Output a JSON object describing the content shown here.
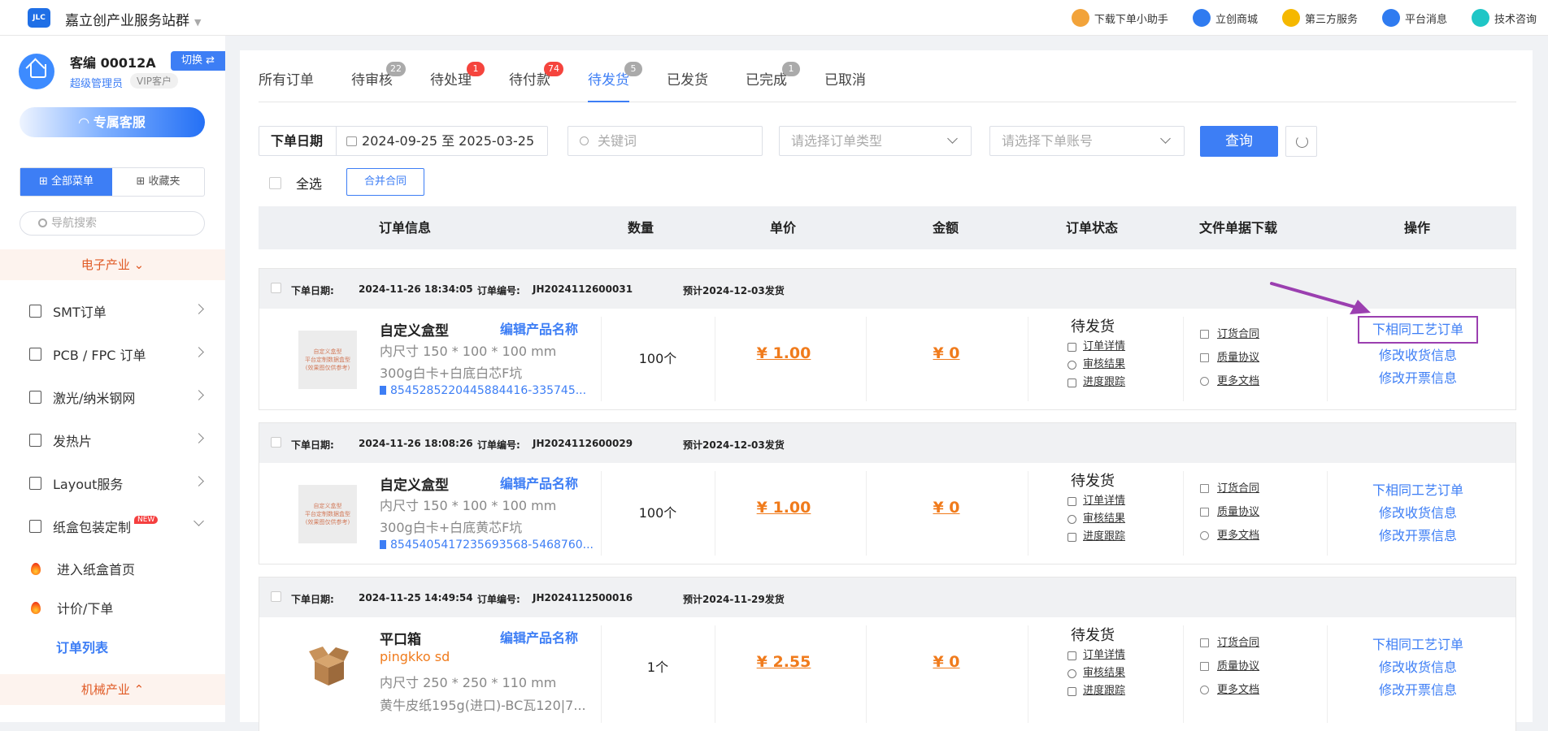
{
  "topbar": {
    "logo_text": "JLC",
    "site_title": "嘉立创产业服务站群",
    "nav": [
      {
        "label": "下载下单小助手",
        "icon": "assistant-icon",
        "color": "#f2a33a"
      },
      {
        "label": "立创商城",
        "icon": "mall-icon",
        "color": "#2f7bf0"
      },
      {
        "label": "第三方服务",
        "icon": "grid-icon",
        "color": "#f5b800"
      },
      {
        "label": "平台消息",
        "icon": "bell-icon",
        "color": "#2f7bf0"
      },
      {
        "label": "技术咨询",
        "icon": "chat-icon",
        "color": "#1fc6c6"
      }
    ]
  },
  "sidebar": {
    "user_name": "客编 00012A",
    "switch_label": "切换 ⇄",
    "role": "超级管理员",
    "vip": "VIP客户",
    "cs_button": "专属客服",
    "menu_tabs": [
      "全部菜单",
      "收藏夹"
    ],
    "search_placeholder": "导航搜索",
    "category_electronics": "电子产业",
    "items": [
      {
        "label": "SMT订单",
        "icon": "smt-icon"
      },
      {
        "label": "PCB / FPC 订单",
        "icon": "pcb-icon"
      },
      {
        "label": "激光/纳米钢网",
        "icon": "stencil-icon"
      },
      {
        "label": "发热片",
        "icon": "heater-icon"
      },
      {
        "label": "Layout服务",
        "icon": "layout-icon"
      },
      {
        "label": "纸盒包装定制",
        "icon": "box-icon",
        "badge": "NEW"
      }
    ],
    "sub_items": [
      "进入纸盒首页",
      "计价/下单",
      "订单列表"
    ],
    "category_machinery": "机械产业"
  },
  "tabs": [
    {
      "label": "所有订单"
    },
    {
      "label": "待审核",
      "badge": "22"
    },
    {
      "label": "待处理",
      "badge": "1"
    },
    {
      "label": "待付款",
      "badge": "74"
    },
    {
      "label": "待发货",
      "badge": "5"
    },
    {
      "label": "已发货"
    },
    {
      "label": "已完成",
      "badge": "1"
    },
    {
      "label": "已取消"
    }
  ],
  "filters": {
    "date_label": "下单日期",
    "date_range": "2024-09-25 至 2025-03-25",
    "keyword_placeholder": "关键词",
    "order_type_placeholder": "请选择订单类型",
    "account_placeholder": "请选择下单账号",
    "query_button": "查询",
    "select_all": "全选",
    "merge_button": "合并合同"
  },
  "table_headers": [
    "订单信息",
    "数量",
    "单价",
    "金额",
    "订单状态",
    "文件单据下载",
    "操作"
  ],
  "orders": [
    {
      "date_label": "下单日期:",
      "date": "2024-11-26 18:34:05",
      "no_label": "订单编号:",
      "order_no": "JH2024112600031",
      "eta": "预计2024-12-03发货",
      "product": "自定义盒型",
      "edit": "编辑产品名称",
      "line1": "内尺寸 150 * 100 * 100 mm",
      "line2": "300g白卡+白底白芯F坑",
      "file": "8545285220445884416-335745...",
      "qty": "100个",
      "price": "¥ 1.00",
      "amount": "¥ 0",
      "status": "待发货",
      "status_links": [
        "订单详情",
        "审核结果",
        "进度跟踪"
      ],
      "file_links": [
        "订货合同",
        "质量协议",
        "更多文档"
      ],
      "ops": [
        "下相同工艺订单",
        "修改收货信息",
        "修改开票信息"
      ],
      "thumb_text": [
        "自定义盒型",
        "平台定制数据盒型",
        "(效果图仅供参考)"
      ]
    },
    {
      "date_label": "下单日期:",
      "date": "2024-11-26 18:08:26",
      "no_label": "订单编号:",
      "order_no": "JH2024112600029",
      "eta": "预计2024-12-03发货",
      "product": "自定义盒型",
      "edit": "编辑产品名称",
      "line1": "内尺寸 150 * 100 * 100 mm",
      "line2": "300g白卡+白底黄芯F坑",
      "file": "8545405417235693568-5468760...",
      "qty": "100个",
      "price": "¥ 1.00",
      "amount": "¥ 0",
      "status": "待发货",
      "status_links": [
        "订单详情",
        "审核结果",
        "进度跟踪"
      ],
      "file_links": [
        "订货合同",
        "质量协议",
        "更多文档"
      ],
      "ops": [
        "下相同工艺订单",
        "修改收货信息",
        "修改开票信息"
      ],
      "thumb_text": [
        "自定义盒型",
        "平台定制数据盒型",
        "(效果图仅供参考)"
      ]
    },
    {
      "date_label": "下单日期:",
      "date": "2024-11-25 14:49:54",
      "no_label": "订单编号:",
      "order_no": "JH2024112500016",
      "eta": "预计2024-11-29发货",
      "product": "平口箱",
      "edit": "编辑产品名称",
      "subtitle": "pingkko sd",
      "line1": "内尺寸 250 * 250 * 110 mm",
      "line2": "黄牛皮纸195g(进口)-BC瓦120|7...",
      "qty": "1个",
      "price": "¥ 2.55",
      "amount": "¥ 0",
      "status": "待发货",
      "status_links": [
        "订单详情",
        "审核结果",
        "进度跟踪"
      ],
      "file_links": [
        "订货合同",
        "质量协议",
        "更多文档"
      ],
      "ops": [
        "下相同工艺订单",
        "修改收货信息",
        "修改开票信息"
      ]
    }
  ],
  "colors": {
    "accent": "#3d7ef5",
    "price": "#f07b1c",
    "highlight": "#9b3fb0"
  }
}
